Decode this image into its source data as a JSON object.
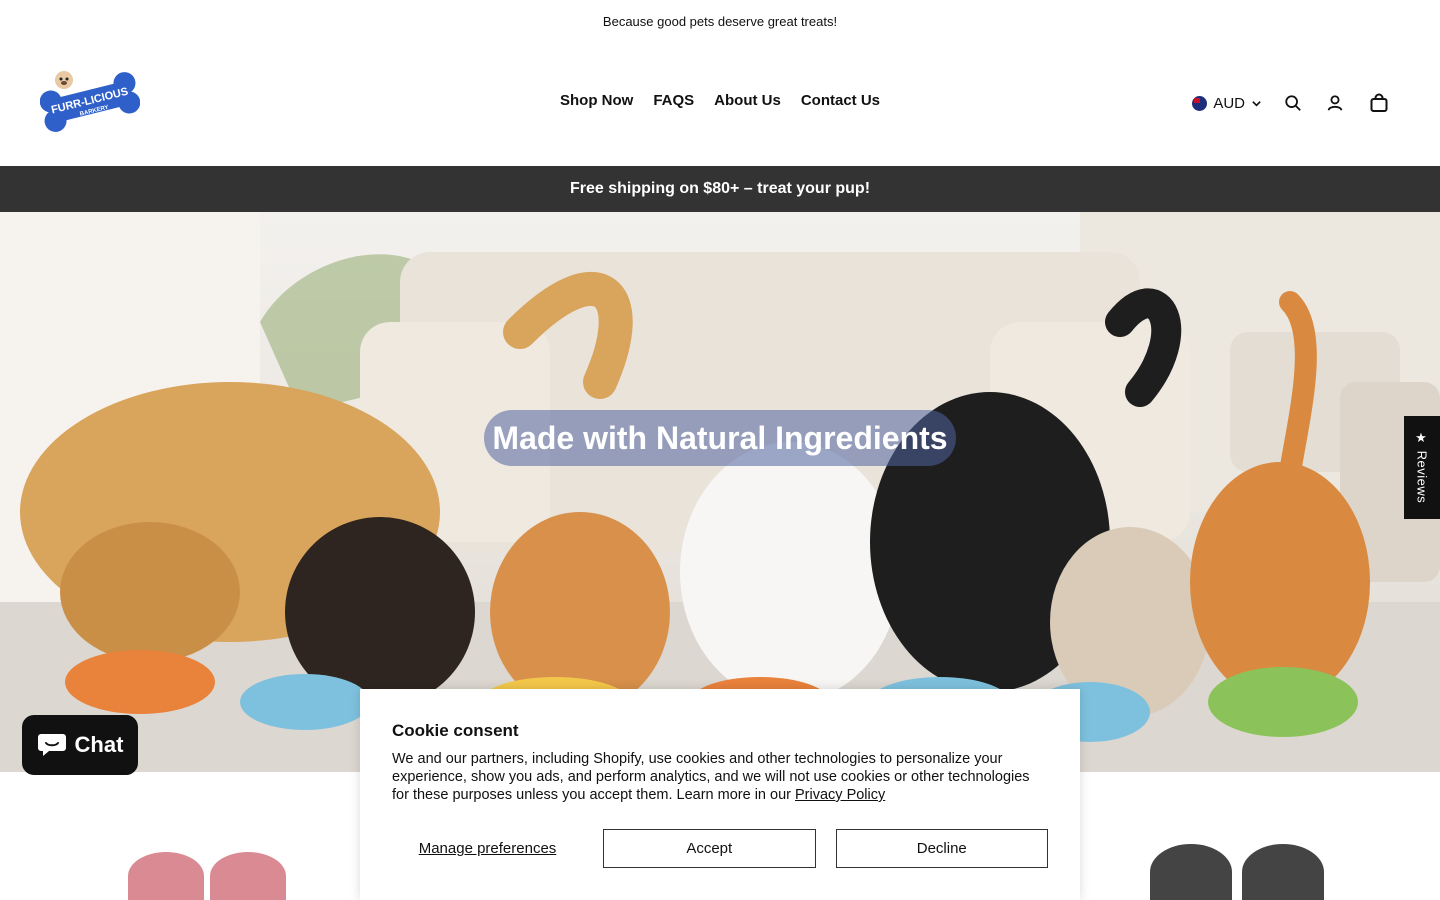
{
  "announcement": {
    "text": "Because good pets deserve great treats!"
  },
  "header": {
    "logo": {
      "line1": "FURR-LICIOUS",
      "line2": "BARKERY",
      "primary_color": "#2f5fc8"
    },
    "nav": [
      {
        "label": "Shop Now"
      },
      {
        "label": "FAQS"
      },
      {
        "label": "About Us"
      },
      {
        "label": "Contact Us"
      }
    ],
    "currency": {
      "code": "AUD",
      "flag": "australia-flag"
    },
    "icons": [
      "search-icon",
      "account-icon",
      "cart-icon"
    ]
  },
  "promo_bar": {
    "text": "Free shipping on $80+ – treat your pup!",
    "background": "#333333"
  },
  "hero": {
    "heading": "Made with Natural Ingredients"
  },
  "reviews_tab": {
    "label": "★ Reviews"
  },
  "chat": {
    "label": "Chat"
  },
  "cookie_consent": {
    "title": "Cookie consent",
    "body": "We and our partners, including Shopify, use cookies and other technologies to personalize your experience, show you ads, and perform analytics, and we will not use cookies or other technologies for these purposes unless you accept them. Learn more in our ",
    "link": "Privacy Policy",
    "manage": "Manage preferences",
    "accept": "Accept",
    "decline": "Decline"
  }
}
